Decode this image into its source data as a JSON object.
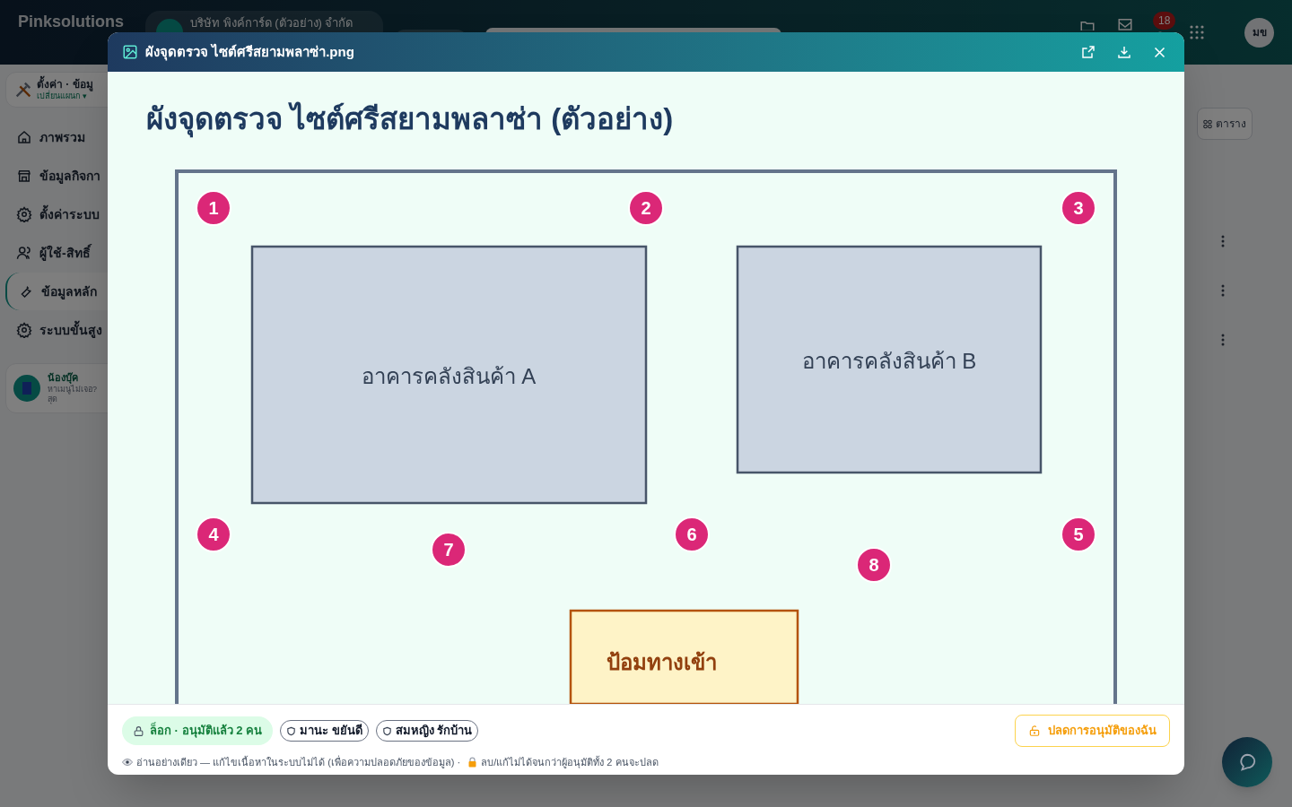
{
  "app": {
    "brand": "Pinksolutions",
    "company": "บริษัท พิงค์การ์ด (ตัวอย่าง) จำกัด",
    "notification_count": "18",
    "avatar": "มข"
  },
  "sidebar": {
    "header": {
      "title": "ตั้งค่า · ข้อมู",
      "subtitle": "เปลี่ยนแผนก ▾"
    },
    "items": [
      {
        "label": "ภาพรวม",
        "selected": false
      },
      {
        "label": "ข้อมูลกิจกา",
        "selected": false
      },
      {
        "label": "ตั้งค่าระบบ",
        "selected": false
      },
      {
        "label": "ผู้ใช้-สิทธิ์",
        "selected": false
      },
      {
        "label": "ข้อมูลหลัก",
        "selected": true
      },
      {
        "label": "ระบบขั้นสูง",
        "selected": false
      }
    ],
    "assistant": {
      "name": "น้องบุ๊ค",
      "text": "หาเมนูไม่เจอ?",
      "text_2": "สุด"
    }
  },
  "content": {
    "view_button": "ตาราง"
  },
  "modal": {
    "title": "ผังจุดตรวจ ไซต์ศรีสยามพลาซ่า.png",
    "image": {
      "title": "ผังจุดตรวจ ไซต์ศรีสยามพลาซ่า (ตัวอย่าง)",
      "areas": [
        {
          "kind": "building",
          "label": "อาคารคลังสินค้า A"
        },
        {
          "kind": "building",
          "label": "อาคารคลังสินค้า B"
        },
        {
          "kind": "gate",
          "label": "ป้อมทางเข้า"
        }
      ],
      "checkpoints": [
        {
          "label": "1"
        },
        {
          "label": "2"
        },
        {
          "label": "3"
        },
        {
          "label": "4"
        },
        {
          "label": "7"
        },
        {
          "label": "6"
        },
        {
          "label": "8"
        },
        {
          "label": "5"
        }
      ]
    },
    "lock": {
      "locked": true,
      "label": "ล็อก · อนุมัติแล้ว 2 คน"
    },
    "approvers": [
      {
        "name": "มานะ ขยันดี"
      },
      {
        "name": "สมหญิง รักบ้าน"
      }
    ],
    "notes": [
      {
        "text": "อ่านอย่างเดียว — แก้ไขเนื้อหาในระบบไม่ได้ (เพื่อความปลอดภัยของข้อมูล) ·"
      },
      {
        "text": "ลบ/แก้ไม่ได้จนกว่าผู้อนุมัติทั้ง 2 คนจะปลด"
      }
    ],
    "unlock_button": "ปลดการอนุมัติของฉัน"
  }
}
